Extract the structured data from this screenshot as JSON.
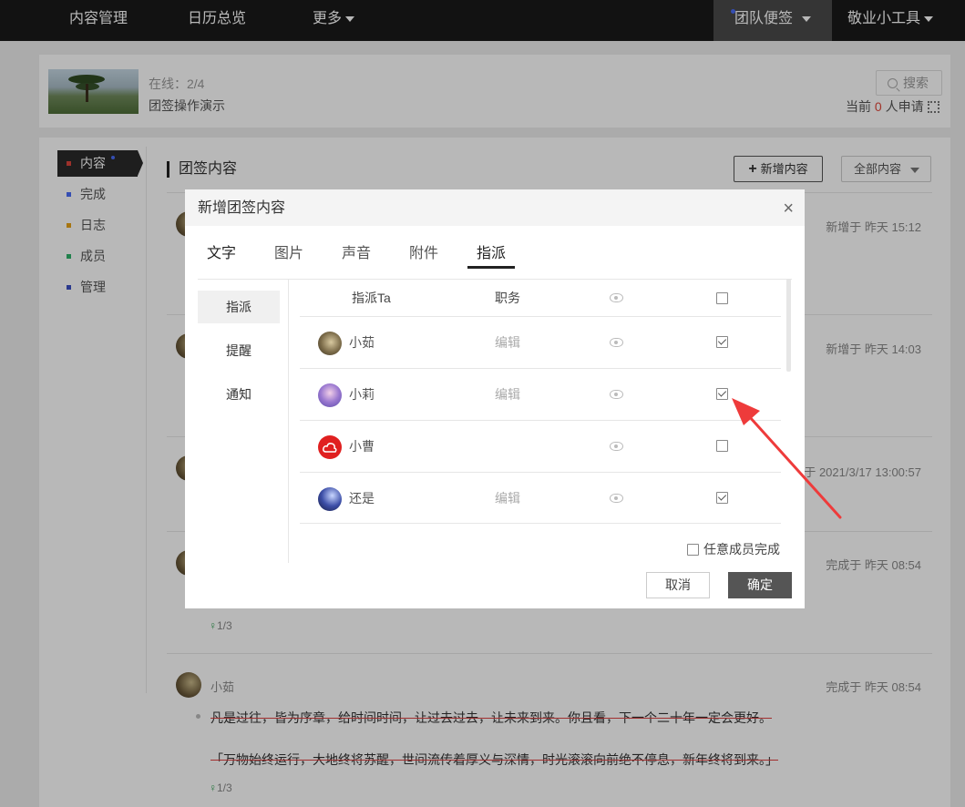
{
  "topnav": {
    "content_mgmt": "内容管理",
    "calendar": "日历总览",
    "more": "更多",
    "team_notes": "团队便签",
    "tools": "敬业小工具"
  },
  "info": {
    "online": "在线：2/4",
    "team_name": "团签操作演示",
    "search": "搜索",
    "apply_prefix": "当前",
    "apply_count": "0",
    "apply_suffix": "人申请"
  },
  "sidebar": {
    "items": [
      {
        "label": "内容",
        "color": "#d9453c"
      },
      {
        "label": "完成",
        "color": "#4a6cf7"
      },
      {
        "label": "日志",
        "color": "#e8a317"
      },
      {
        "label": "成员",
        "color": "#2fb36a"
      },
      {
        "label": "管理",
        "color": "#3b4fc4"
      }
    ]
  },
  "main": {
    "section_title": "团签内容",
    "add_button": "新增内容",
    "filter": "全部内容"
  },
  "feed": [
    {
      "time": "新增于 昨天 15:12"
    },
    {
      "time": "新增于 昨天 14:03"
    },
    {
      "time": "于 2021/3/17 13:00:57"
    },
    {
      "time": "完成于 昨天 08:54",
      "count": "1/3"
    },
    {
      "author": "小茹",
      "time": "完成于 昨天 08:54",
      "line1": "凡是过往，皆为序章，给时间时间，让过去过去，让未来到来。你且看，下一个二十年一定会更好。",
      "line2": "「万物始终运行，大地终将苏醒，世间流传着厚义与深情，时光滚滚向前绝不停息，新年终将到来。」",
      "count": "1/3"
    }
  ],
  "modal": {
    "title": "新增团签内容",
    "tabs": [
      "文字",
      "图片",
      "声音",
      "附件",
      "指派"
    ],
    "active_tab": "指派",
    "left_nav": [
      "指派",
      "提醒",
      "通知"
    ],
    "table_header": {
      "assign": "指派Ta",
      "duty": "职务"
    },
    "members": [
      {
        "name": "小茹",
        "duty": "编辑",
        "checked": true
      },
      {
        "name": "小莉",
        "duty": "编辑",
        "checked": true
      },
      {
        "name": "小曹",
        "duty": "",
        "checked": false
      },
      {
        "name": "还是",
        "duty": "编辑",
        "checked": true
      }
    ],
    "any_member_done": "任意成员完成",
    "cancel": "取消",
    "ok": "确定"
  },
  "colors": {
    "annotation_arrow": "#ee3b3b",
    "ok_button": "#555555"
  }
}
